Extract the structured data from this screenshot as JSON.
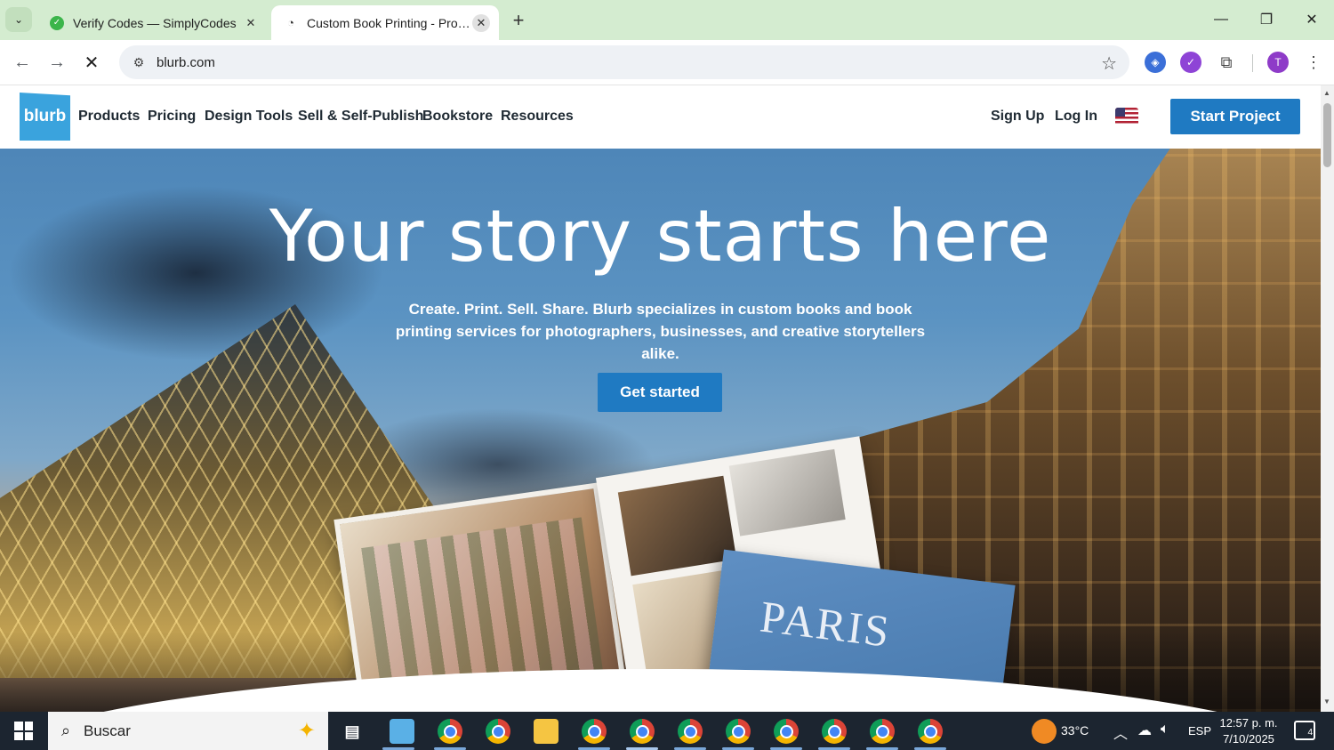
{
  "browser": {
    "tabs": [
      {
        "title": "Verify Codes — SimplyCodes",
        "active": false
      },
      {
        "title": "Custom Book Printing - Profess",
        "active": true
      }
    ],
    "url": "blurb.com",
    "profile_initial": "T"
  },
  "site": {
    "logo": "blurb",
    "nav": [
      "Products",
      "Pricing",
      "Design Tools",
      "Sell & Self-Publish",
      "Bookstore",
      "Resources"
    ],
    "sign_up": "Sign Up",
    "log_in": "Log In",
    "start_project": "Start Project"
  },
  "hero": {
    "title": "Your story starts here",
    "subtitle": "Create. Print. Sell. Share. Blurb specializes in custom books and book printing services for photographers, businesses, and creative storytellers alike.",
    "cta": "Get started",
    "book_title": "PARIS"
  },
  "taskbar": {
    "search_placeholder": "Buscar",
    "temperature": "33°C",
    "language": "ESP",
    "time": "12:57 p. m.",
    "date": "7/10/2025",
    "notifications": "4"
  },
  "colors": {
    "accent": "#1f7ac2",
    "logo": "#3aa3dd",
    "tabbar": "#d4ecd0"
  }
}
